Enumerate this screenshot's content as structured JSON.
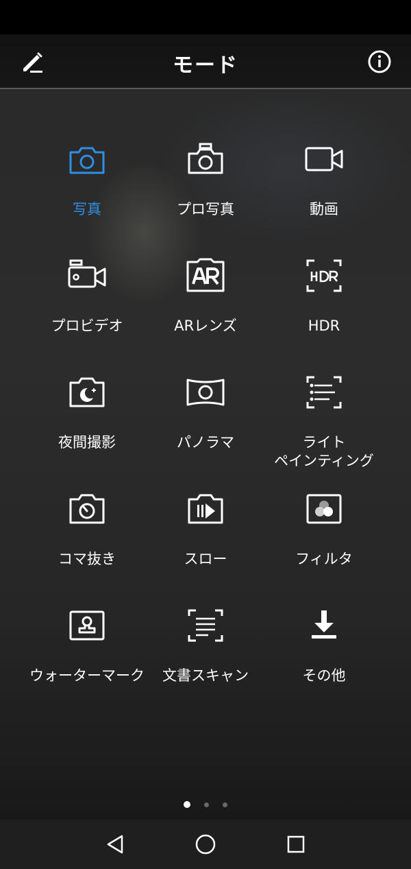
{
  "header": {
    "title": "モード",
    "edit_icon": "pencil-icon",
    "info_icon": "info-icon"
  },
  "colors": {
    "accent": "#2f8fe3",
    "text": "#ffffff"
  },
  "modes": [
    {
      "label": "写真",
      "icon": "camera-icon",
      "selected": true
    },
    {
      "label": "プロ写真",
      "icon": "pro-camera-icon",
      "selected": false
    },
    {
      "label": "動画",
      "icon": "video-icon",
      "selected": false
    },
    {
      "label": "プロビデオ",
      "icon": "pro-video-icon",
      "selected": false
    },
    {
      "label": "ARレンズ",
      "icon": "ar-icon",
      "selected": false
    },
    {
      "label": "HDR",
      "icon": "hdr-icon",
      "selected": false
    },
    {
      "label": "夜間撮影",
      "icon": "night-icon",
      "selected": false
    },
    {
      "label": "パノラマ",
      "icon": "panorama-icon",
      "selected": false
    },
    {
      "label": "ライト\nペインティング",
      "icon": "light-painting-icon",
      "selected": false
    },
    {
      "label": "コマ抜き",
      "icon": "time-lapse-icon",
      "selected": false
    },
    {
      "label": "スロー",
      "icon": "slow-motion-icon",
      "selected": false
    },
    {
      "label": "フィルタ",
      "icon": "filter-icon",
      "selected": false
    },
    {
      "label": "ウォーターマーク",
      "icon": "watermark-icon",
      "selected": false
    },
    {
      "label": "文書スキャン",
      "icon": "document-scan-icon",
      "selected": false
    },
    {
      "label": "その他",
      "icon": "download-icon",
      "selected": false
    }
  ],
  "pagination": {
    "pages": 3,
    "current": 1
  },
  "navbar": {
    "back_icon": "back-triangle-icon",
    "home_icon": "home-circle-icon",
    "recent_icon": "recent-square-icon"
  }
}
